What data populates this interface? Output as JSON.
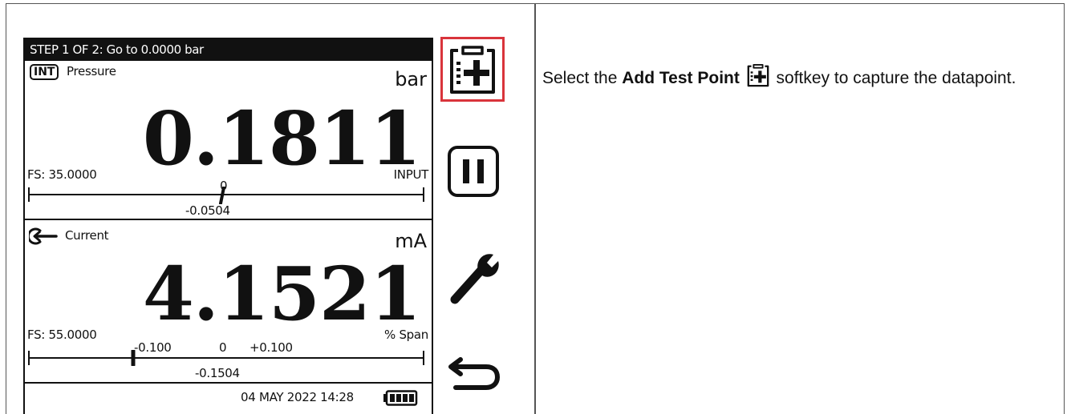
{
  "device": {
    "step_title": "STEP 1 OF 2: Go to 0.0000 bar",
    "pressure": {
      "badge": "INT",
      "label": "Pressure",
      "unit": "bar",
      "value": "0.1811",
      "fs_label": "FS: 35.0000",
      "mode": "INPUT",
      "scale_center_label": "0",
      "scale_reading": "-0.0504"
    },
    "current": {
      "label": "Current",
      "unit": "mA",
      "value": "4.1521",
      "fs_label": "FS: 55.0000",
      "span_label": "% Span",
      "scale_left": "-0.100",
      "scale_center": "0",
      "scale_right": "+0.100",
      "scale_reading": "-0.1504"
    },
    "status": {
      "datetime": "04 MAY 2022 14:28",
      "battery_icon": "battery-full-icon"
    }
  },
  "softkeys": [
    {
      "icon": "add-test-point-icon",
      "highlighted": true
    },
    {
      "icon": "pause-icon"
    },
    {
      "icon": "wrench-icon"
    },
    {
      "icon": "back-arrow-icon"
    }
  ],
  "instruction": {
    "prefix": "Select the",
    "bold": "Add Test Point",
    "suffix": "softkey to capture the datapoint."
  },
  "colors": {
    "highlight": "#d9343b",
    "screen_bar": "#111111"
  }
}
